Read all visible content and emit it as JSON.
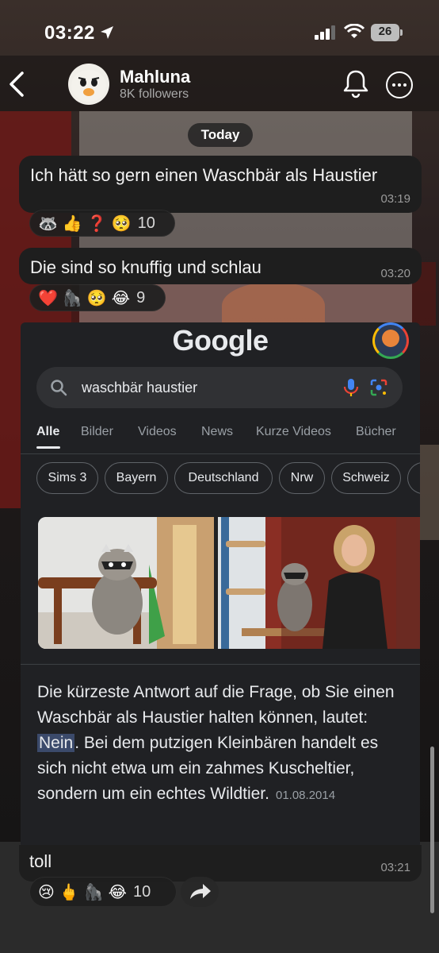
{
  "status_bar": {
    "time": "03:22",
    "battery": "26",
    "icons": [
      "location-arrow-icon",
      "signal-icon",
      "wifi-icon",
      "battery-icon"
    ]
  },
  "header": {
    "channel_name": "Mahluna",
    "followers": "8K followers",
    "icons": [
      "back-chevron-icon",
      "bell-icon",
      "more-icon"
    ]
  },
  "date_separator": "Today",
  "messages": [
    {
      "text": "Ich hätt so gern einen Waschbär als Haustier",
      "time": "03:19",
      "reactions": [
        "🦝",
        "👍",
        "❓",
        "🥺"
      ],
      "reaction_count": "10"
    },
    {
      "text": "Die sind so knuffig und schlau",
      "time": "03:20",
      "reactions": [
        "❤️",
        "🦍",
        "🥺",
        "😂"
      ],
      "reaction_count": "9"
    },
    {
      "text": "toll",
      "time": "03:21",
      "reactions": [
        "😢",
        "🖕",
        "🦍",
        "😂"
      ],
      "reaction_count": "10"
    }
  ],
  "google": {
    "logo": "Google",
    "query": "waschbär haustier",
    "tabs": [
      "Alle",
      "Bilder",
      "Videos",
      "News",
      "Kurze Videos",
      "Bücher"
    ],
    "active_tab": "Alle",
    "chips": [
      "Sims 3",
      "Bayern",
      "Deutschland",
      "Nrw",
      "Schweiz"
    ],
    "answer_before": "Die kürzeste Antwort auf die Frage, ob Sie einen Waschbär als Haustier halten können, lautet: ",
    "answer_highlight": "Nein",
    "answer_after": ". Bei dem putzigen Kleinbären handelt es sich nicht etwa um ein zahmes Kuscheltier, sondern um ein echtes Wildtier.",
    "answer_date": "01.08.2014"
  },
  "colors": {
    "bubble": "#1e1e1e",
    "google_bg": "#202124",
    "google_blue": "#4285f4",
    "google_red": "#ea4335",
    "google_yellow": "#fbbc05",
    "google_green": "#34a853"
  }
}
